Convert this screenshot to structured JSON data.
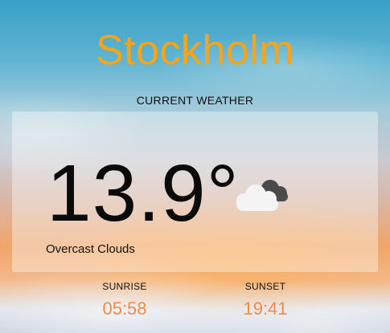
{
  "city": "Stockholm",
  "section_label": "CURRENT WEATHER",
  "current": {
    "temperature": "13.9°",
    "description": "Overcast Clouds",
    "icon": "overcast-clouds-icon"
  },
  "sun": {
    "sunrise_label": "SUNRISE",
    "sunrise_time": "05:58",
    "sunset_label": "SUNSET",
    "sunset_time": "19:41"
  },
  "colors": {
    "accent": "#f7a418",
    "time": "#f08a4a",
    "text": "#111111"
  }
}
